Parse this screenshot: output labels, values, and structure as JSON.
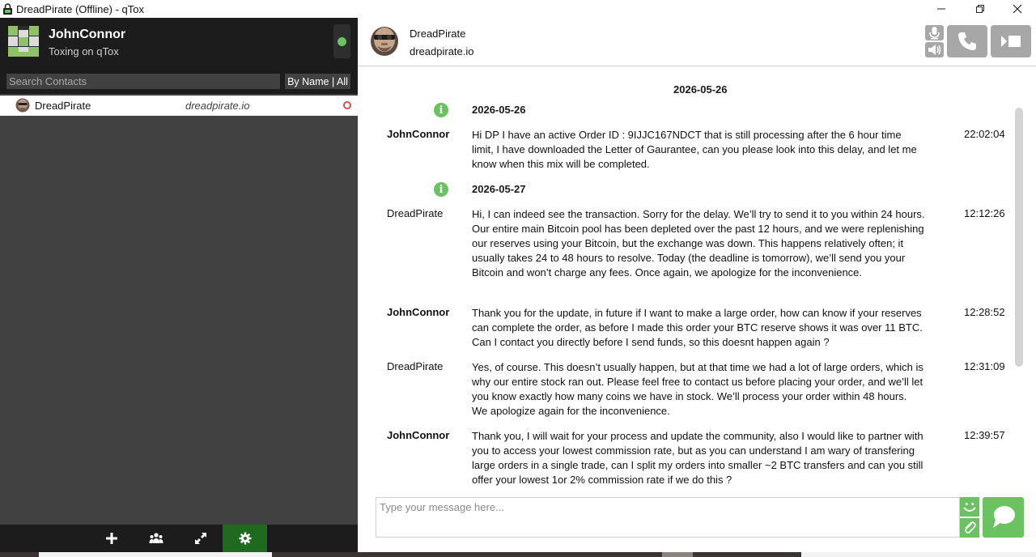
{
  "window": {
    "title": "DreadPirate (Offline) - qTox",
    "icons": {
      "app": "lock-app-icon",
      "minimize": "minimize-icon",
      "maximize": "restore-icon",
      "close": "close-icon"
    }
  },
  "profile": {
    "name": "JohnConnor",
    "status_message": "Toxing on qTox",
    "status": "online",
    "status_color": "#6bc260"
  },
  "search": {
    "placeholder": "Search Contacts",
    "sort_label": "By Name | All"
  },
  "contacts": [
    {
      "name": "DreadPirate",
      "status_message": "dreadpirate.io",
      "status": "offline",
      "status_color": "#d9534f"
    }
  ],
  "bottom_bar": {
    "buttons": [
      {
        "icon": "add-icon",
        "active": false
      },
      {
        "icon": "group-icon",
        "active": false
      },
      {
        "icon": "file-transfer-icon",
        "active": false
      },
      {
        "icon": "settings-icon",
        "active": true
      }
    ]
  },
  "chat": {
    "peer_name": "DreadPirate",
    "peer_status": "dreadpirate.io",
    "top_date": "2026-05-26",
    "date_separators": [
      "2026-05-26",
      "2026-05-27"
    ],
    "messages": [
      {
        "author": "JohnConnor",
        "self": true,
        "time": "22:02:04",
        "text": "Hi DP I have an active Order ID : 9IJJC167NDCT that is still processing after the 6 hour time limit, I have downloaded the Letter of Gaurantee, can you please look into this delay, and let me know when this mix will be completed."
      },
      {
        "author": "DreadPirate",
        "self": false,
        "time": "12:12:26",
        "text": "Hi, I can indeed see the transaction. Sorry for the delay. We’ll try to send it to you within 24 hours. Our entire main Bitcoin pool has been depleted over the past 12 hours, and we were replenishing our reserves using your Bitcoin, but the exchange was down. This happens relatively often; it usually takes 24 to 48 hours to resolve. Today (the deadline is tomorrow), we’ll send you your Bitcoin and won’t charge any fees. Once again, we apologize for the inconvenience."
      },
      {
        "author": "JohnConnor",
        "self": true,
        "time": "12:28:52",
        "text": "Thank you for the update, in future if I want to make a large order, how can know if your reserves can complete the order, as before I made this order your BTC reserve shows it was over 11 BTC. Can I contact you directly before I send funds, so this doesnt happen again ?"
      },
      {
        "author": "DreadPirate",
        "self": false,
        "time": "12:31:09",
        "text": "Yes, of course. This doesn’t usually happen, but at that time we had a lot of large orders, which is why our entire stock ran out. Please feel free to contact us before placing your order, and we’ll let you know exactly how many coins we have in stock. We’ll process your order within 48 hours. We apologize again for the inconvenience."
      },
      {
        "author": "JohnConnor",
        "self": true,
        "time": "12:39:57",
        "text": "Thank you, I will wait for your process and update the community, also I would like to partner with you to access your lowest commission rate, but as you can understand I am wary of transfering large orders in a single trade, can I split my orders into smaller ~2 BTC transfers and can you still offer your lowest 1or 2% commission rate if we do this ?"
      }
    ],
    "input_placeholder": "Type your message here...",
    "input_value": ""
  },
  "colors": {
    "accent": "#6bc260",
    "dark_bg": "#1c1c1c",
    "panel_bg": "#414141",
    "active_tab": "#1e6a1e"
  }
}
